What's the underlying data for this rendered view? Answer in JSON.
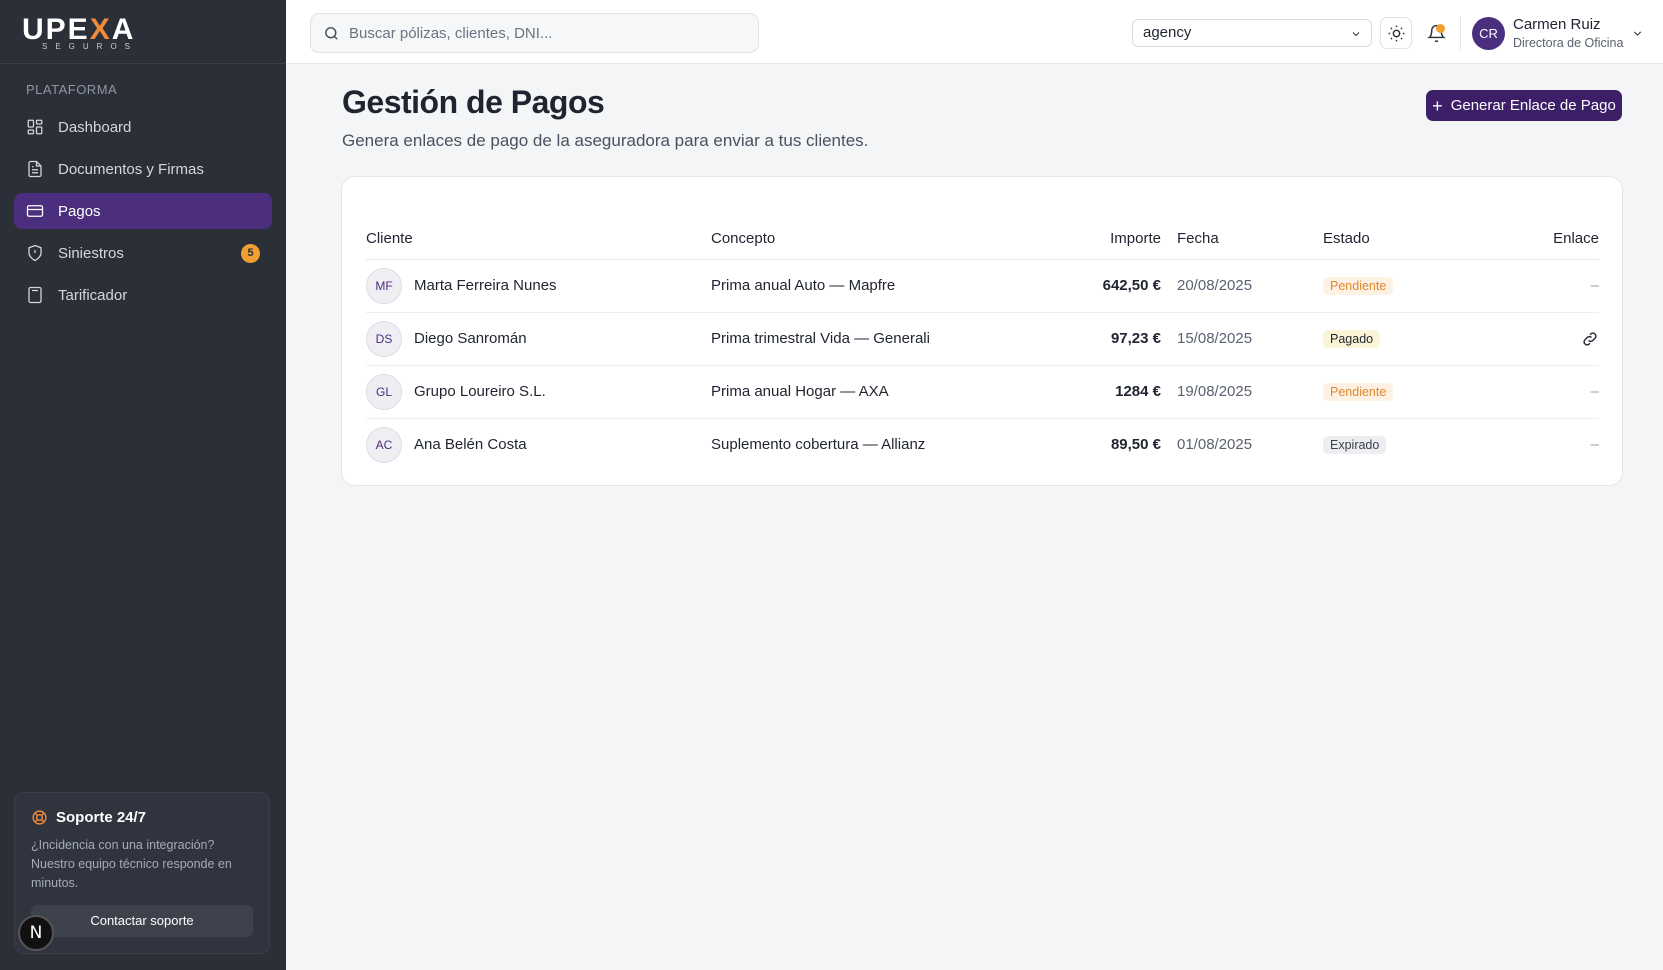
{
  "brand": {
    "logo_main": "UPE",
    "logo_x": "X",
    "logo_end": "A",
    "logo_sub": "SEGUROS",
    "accent_color": "#4b2e7e",
    "orange": "#f08a3c"
  },
  "sidebar": {
    "section_label": "PLATAFORMA",
    "items": [
      {
        "label": "Dashboard",
        "icon": "dashboard-icon"
      },
      {
        "label": "Documentos y Firmas",
        "icon": "document-icon"
      },
      {
        "label": "Pagos",
        "icon": "credit-card-icon",
        "active": true
      },
      {
        "label": "Siniestros",
        "icon": "shield-icon",
        "badge": "5"
      },
      {
        "label": "Tarificador",
        "icon": "calculator-icon"
      }
    ],
    "support": {
      "title": "Soporte 24/7",
      "text": "¿Incidencia con una integración? Nuestro equipo técnico responde en minutos.",
      "button": "Contactar soporte"
    },
    "corner_badge": "N"
  },
  "topbar": {
    "search_placeholder": "Buscar pólizas, clientes, DNI...",
    "select_value": "agency",
    "user": {
      "initials": "CR",
      "name": "Carmen Ruiz",
      "role": "Directora de Oficina"
    }
  },
  "main": {
    "title": "Gestión de Pagos",
    "subtitle": "Genera enlaces de pago de la aseguradora para enviar a tus clientes.",
    "primary_button": "Generar Enlace de Pago",
    "table": {
      "headers": {
        "client": "Cliente",
        "concept": "Concepto",
        "amount": "Importe",
        "date": "Fecha",
        "state": "Estado",
        "link": "Enlace"
      },
      "rows": [
        {
          "initials": "MF",
          "client": "Marta Ferreira Nunes",
          "concept": "Prima anual Auto — Mapfre",
          "amount": "642,50 €",
          "date": "20/08/2025",
          "state": "Pendiente",
          "link": "–"
        },
        {
          "initials": "DS",
          "client": "Diego Sanromán",
          "concept": "Prima trimestral Vida — Generali",
          "amount": "97,23 €",
          "date": "15/08/2025",
          "state": "Pagado",
          "link": ""
        },
        {
          "initials": "GL",
          "client": "Grupo Loureiro S.L.",
          "concept": "Prima anual Hogar — AXA",
          "amount": "1284 €",
          "date": "19/08/2025",
          "state": "Pendiente",
          "link": "–"
        },
        {
          "initials": "AC",
          "client": "Ana Belén Costa",
          "concept": "Suplemento cobertura — Allianz",
          "amount": "89,50 €",
          "date": "01/08/2025",
          "state": "Expirado",
          "link": "–"
        }
      ]
    }
  }
}
